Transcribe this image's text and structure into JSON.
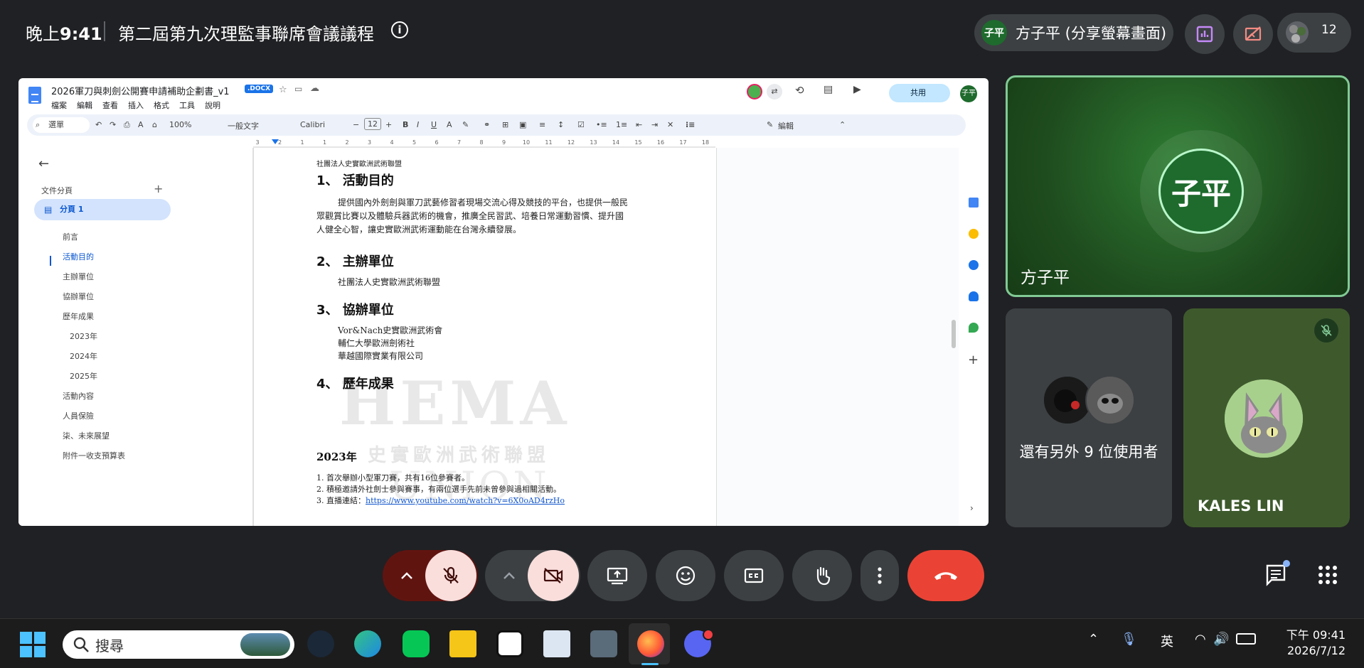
{
  "topbar": {
    "time_prefix": "晚上",
    "time": "9:41",
    "meeting_title": "第二屆第九次理監事聯席會議議程",
    "presenter_initials": "子平",
    "presenter_label": "方子平 (分享螢幕畫面)",
    "participant_count": "12"
  },
  "doc": {
    "filename": "2026軍刀與刺劍公開賽申請補助企劃書_v1",
    "ext_badge": ".DOCX",
    "menus": [
      "檔案",
      "編輯",
      "查看",
      "插入",
      "格式",
      "工具",
      "說明"
    ],
    "toolbar": {
      "search": "選單",
      "zoom": "100%",
      "style": "一般文字",
      "font": "Calibri",
      "size": "12",
      "edit_mode": "編輯",
      "share": "共用"
    },
    "ruler_ticks": [
      "3",
      "2",
      "1",
      "1",
      "2",
      "3",
      "4",
      "5",
      "6",
      "7",
      "8",
      "9",
      "10",
      "11",
      "12",
      "13",
      "14",
      "15",
      "16",
      "17",
      "18"
    ],
    "left_pane": {
      "section_title": "文件分頁",
      "tab_label": "分頁 1",
      "outline": [
        {
          "label": "前言",
          "level": 1
        },
        {
          "label": "活動目的",
          "level": 1,
          "active": true
        },
        {
          "label": "主辦單位",
          "level": 1
        },
        {
          "label": "協辦單位",
          "level": 1
        },
        {
          "label": "歷年成果",
          "level": 1
        },
        {
          "label": "2023年",
          "level": 2
        },
        {
          "label": "2024年",
          "level": 2
        },
        {
          "label": "2025年",
          "level": 2
        },
        {
          "label": "活動內容",
          "level": 1
        },
        {
          "label": "人員保險",
          "level": 1
        },
        {
          "label": "柒、未來展望",
          "level": 1
        },
        {
          "label": "附件一收支預算表",
          "level": 1
        }
      ]
    },
    "page": {
      "header": "社團法人史實歐洲武術聯盟",
      "h1": "1、 活動目的",
      "p1": "提供國內外劍劍與軍刀武藝修習者現場交流心得及競技的平台，也提供一般民眾觀賞比賽以及體驗兵器武術的機會，推廣全民習武、培養日常運動習慣、提升國人健全心智，讓史實歐洲武術運動能在台灣永續發展。",
      "h2": "2、 主辦單位",
      "p2": "社團法人史實歐洲武術聯盟",
      "h3": "3、 協辦單位",
      "p3a": "Vor&Nach史實歐洲武術會",
      "p3b": "輔仁大學歐洲劍術社",
      "p3c": "華越國際實業有限公司",
      "h4": "4、 歷年成果",
      "y2023": "2023年",
      "li1": "1.  首次舉辦小型軍刀賽，共有16位參賽者。",
      "li2": "2.  積極邀請外社劍士參與賽事，有兩位選手先前未曾參與過相關活動。",
      "li3_prefix": "3.  直播連結：",
      "li3_link": "https://www.youtube.com/watch?v=6X0oAD4rzHo",
      "watermark": "HEMA",
      "watermark2": "史實歐洲武術聯盟",
      "watermark3": "UNION"
    }
  },
  "tiles": {
    "main_initials": "子平",
    "main_name": "方子平",
    "others_text": "還有另外 9 位使用者",
    "third_name": "KALES LIN"
  },
  "taskbar": {
    "search_placeholder": "搜尋",
    "ime": "英",
    "clock_time": "下午 09:41",
    "clock_date": "2026/7/12"
  },
  "colors": {
    "accent_green": "#81c995",
    "end_call": "#ea4335",
    "muted_bg": "#f9dedc"
  }
}
